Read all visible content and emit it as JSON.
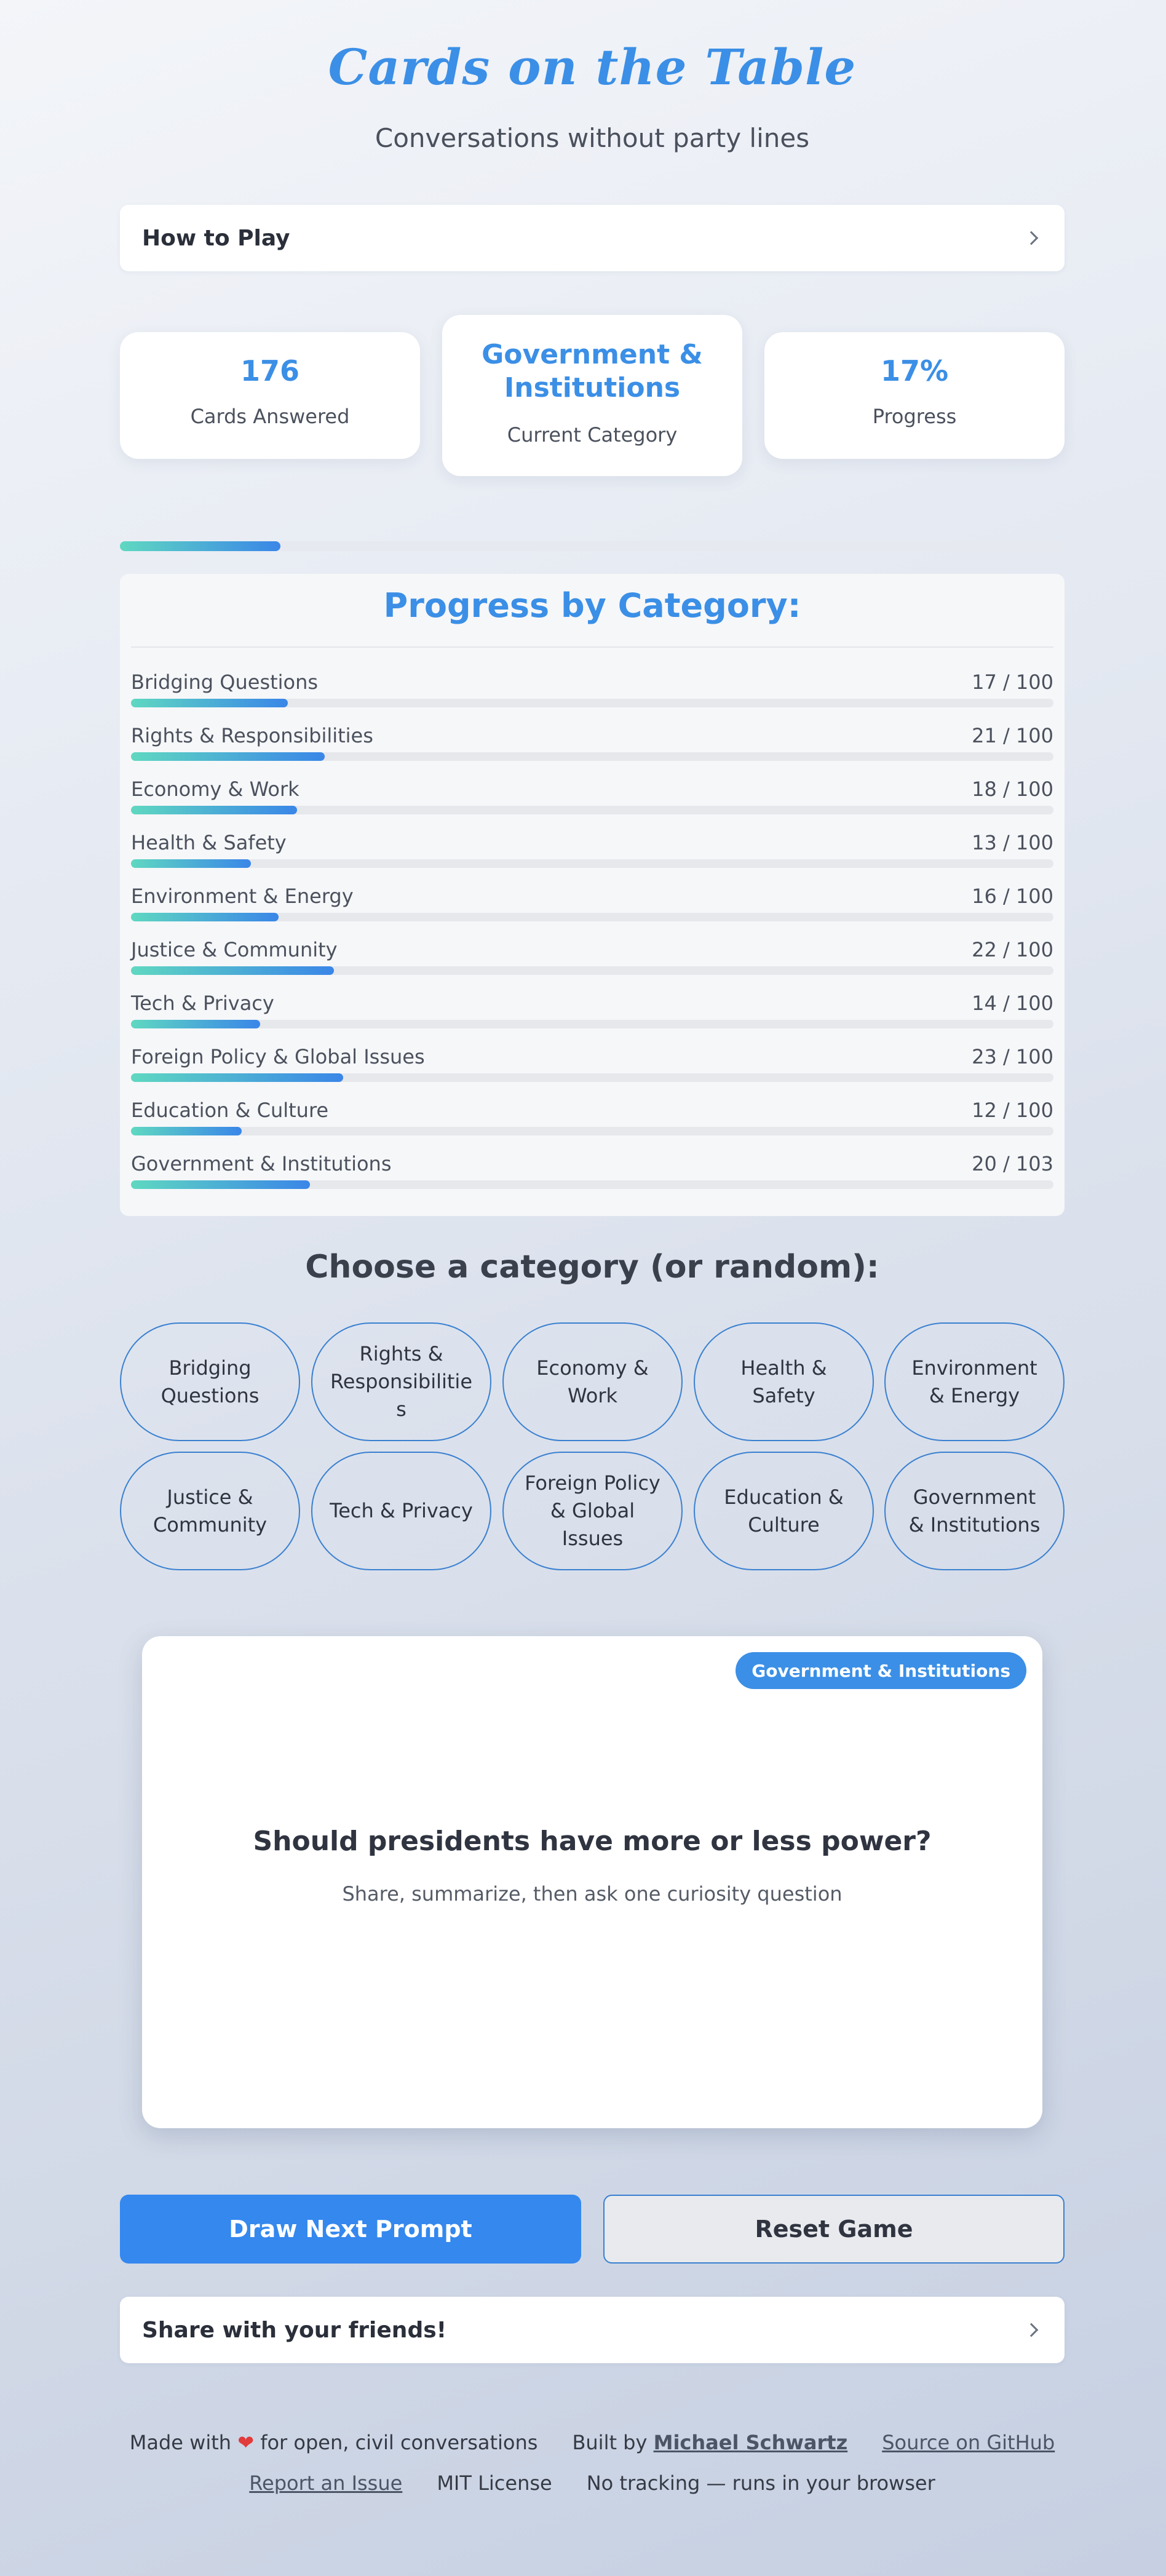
{
  "header": {
    "title": "Cards on the Table",
    "subtitle": "Conversations without party lines"
  },
  "how_to_play": {
    "label": "How to Play",
    "icon": "chevron-right-icon"
  },
  "stats": [
    {
      "value": "176",
      "label": "Cards Answered"
    },
    {
      "value": "Government & Institutions",
      "label": "Current Category"
    },
    {
      "value": "17%",
      "label": "Progress"
    }
  ],
  "overall_progress": 0.17,
  "progress_panel": {
    "title": "Progress by Category:",
    "categories": [
      {
        "name": "Bridging Questions",
        "answered": 17,
        "total": 100,
        "count_text": "17 / 100"
      },
      {
        "name": "Rights & Responsibilities",
        "answered": 21,
        "total": 100,
        "count_text": "21 / 100"
      },
      {
        "name": "Economy & Work",
        "answered": 18,
        "total": 100,
        "count_text": "18 / 100"
      },
      {
        "name": "Health & Safety",
        "answered": 13,
        "total": 100,
        "count_text": "13 / 100"
      },
      {
        "name": "Environment & Energy",
        "answered": 16,
        "total": 100,
        "count_text": "16 / 100"
      },
      {
        "name": "Justice & Community",
        "answered": 22,
        "total": 100,
        "count_text": "22 / 100"
      },
      {
        "name": "Tech & Privacy",
        "answered": 14,
        "total": 100,
        "count_text": "14 / 100"
      },
      {
        "name": "Foreign Policy & Global Issues",
        "answered": 23,
        "total": 100,
        "count_text": "23 / 100"
      },
      {
        "name": "Education & Culture",
        "answered": 12,
        "total": 100,
        "count_text": "12 / 100"
      },
      {
        "name": "Government & Institutions",
        "answered": 20,
        "total": 103,
        "count_text": "20 / 103"
      }
    ]
  },
  "chooser": {
    "title": "Choose a category (or random):",
    "buttons": [
      "Bridging Questions",
      "Rights & Responsibilities",
      "Economy & Work",
      "Health & Safety",
      "Environment & Energy",
      "Justice & Community",
      "Tech & Privacy",
      "Foreign Policy & Global Issues",
      "Education & Culture",
      "Government & Institutions"
    ]
  },
  "prompt_card": {
    "badge": "Government & Institutions",
    "question": "Should presidents have more or less power?",
    "hint": "Share, summarize, then ask one curiosity question"
  },
  "actions": {
    "draw_label": "Draw Next Prompt",
    "reset_label": "Reset Game"
  },
  "share": {
    "label": "Share with your friends!",
    "icon": "chevron-right-icon"
  },
  "footer": {
    "made_with_prefix": "Made with",
    "heart_icon": "heart-icon",
    "made_with_suffix": "for open, civil conversations",
    "built_by_prefix": "Built by",
    "author": "Michael Schwartz",
    "source_link": "Source on GitHub",
    "report_link": "Report an Issue",
    "license": "MIT License",
    "privacy": "No tracking — runs in your browser"
  },
  "colors": {
    "accent": "#3b8fe6",
    "progress_start": "#5fd8c1",
    "progress_end": "#3a86e8",
    "heart": "#e23b3b"
  }
}
